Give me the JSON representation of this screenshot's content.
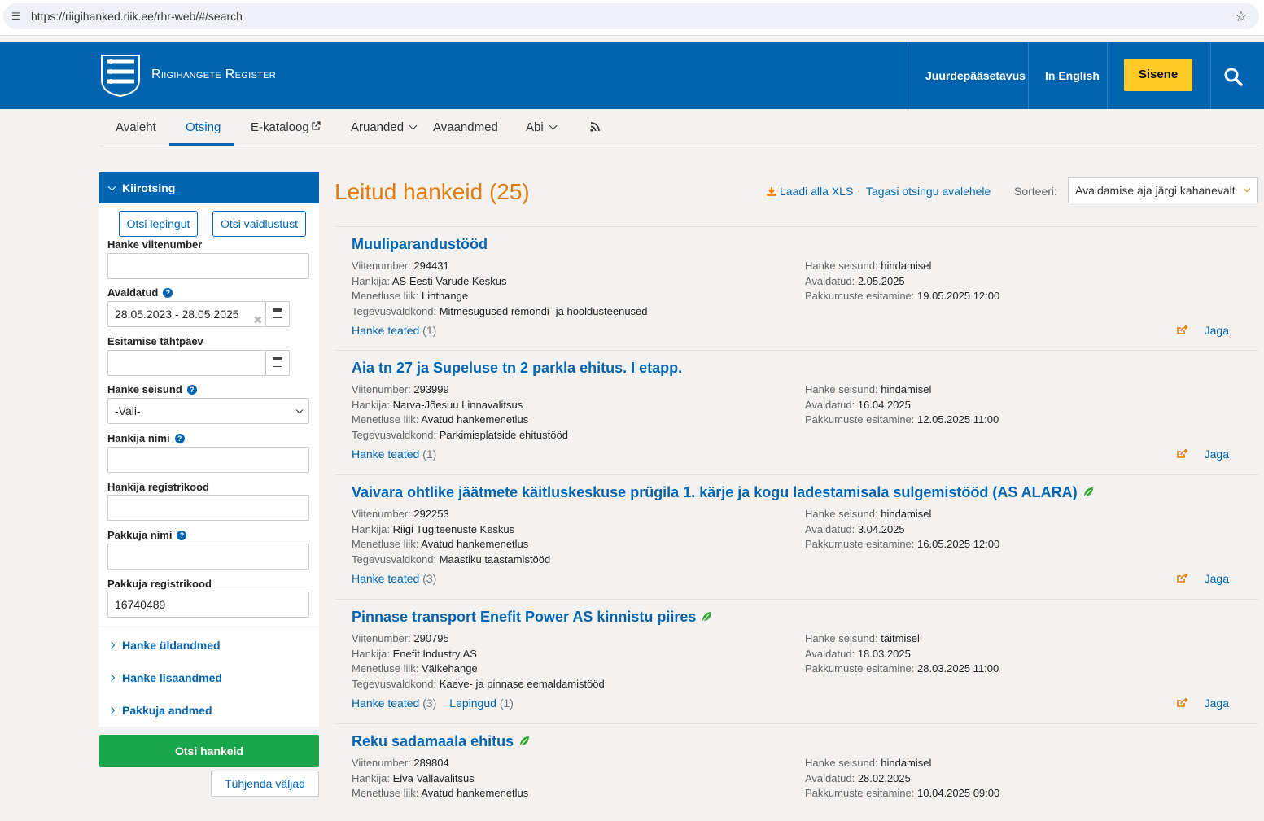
{
  "browser": {
    "url": "https://riigihanked.riik.ee/rhr-web/#/search"
  },
  "header": {
    "brand": "Riigihangete Register",
    "accessibility": "Juurdepääsetavus",
    "english": "In English",
    "login": "Sisene"
  },
  "nav": {
    "items": [
      "Avaleht",
      "Otsing",
      "E-kataloog",
      "Aruanded",
      "Avaandmed",
      "Abi"
    ]
  },
  "sidebar": {
    "title": "Kiirotsing",
    "btn_contract": "Otsi lepingut",
    "btn_dispute": "Otsi vaidlustust",
    "f_ref": "Hanke viitenumber",
    "f_published": "Avaldatud",
    "published_value": "28.05.2023 - 28.05.2025",
    "f_deadline": "Esitamise tähtpäev",
    "f_state": "Hanke seisund",
    "state_value": "-Vali-",
    "f_buyer": "Hankija nimi",
    "f_buyer_reg": "Hankija registrikood",
    "f_bidder": "Pakkuja nimi",
    "f_bidder_reg": "Pakkuja registrikood",
    "bidder_reg_value": "16740489",
    "acc1": "Hanke üldandmed",
    "acc2": "Hanke lisaandmed",
    "acc3": "Pakkuja andmed",
    "search_btn": "Otsi hankeid",
    "clear_btn": "Tühjenda väljad"
  },
  "results": {
    "title_prefix": "Leitud hankeid",
    "count": "(25)",
    "download": "Laadi alla XLS",
    "back": "Tagasi otsingu avalehele",
    "sort_label": "Sorteeri:",
    "sort_value": "Avaldamise aja järgi kahanevalt",
    "labels": {
      "ref": "Viitenumber:",
      "buyer": "Hankija:",
      "proc": "Menetluse liik:",
      "field": "Tegevusvaldkond:",
      "state": "Hanke seisund:",
      "pub": "Avaldatud:",
      "bids": "Pakkumuste esitamine:",
      "notices": "Hanke teated",
      "contracts": "Lepingud",
      "share": "Jaga"
    },
    "items": [
      {
        "title": "Muuliparandustööd",
        "ref": "294431",
        "buyer": "AS Eesti Varude Keskus",
        "proc": "Lihthange",
        "field": "Mitmesugused remondi- ja hooldusteenused",
        "state": "hindamisel",
        "pub": "2.05.2025",
        "bids": "19.05.2025 12:00",
        "notices": "(1)"
      },
      {
        "title": "Aia tn 27 ja Supeluse tn 2 parkla ehitus. I etapp.",
        "ref": "293999",
        "buyer": "Narva-Jõesuu Linnavalitsus",
        "proc": "Avatud hankemenetlus",
        "field": "Parkimisplatside ehitustööd",
        "state": "hindamisel",
        "pub": "16.04.2025",
        "bids": "12.05.2025 11:00",
        "notices": "(1)"
      },
      {
        "title": "Vaivara ohtlike jäätmete käitluskeskuse prügila 1. kärje ja kogu ladestamisala sulgemistööd (AS ALARA)",
        "ref": "292253",
        "buyer": "Riigi Tugiteenuste Keskus",
        "proc": "Avatud hankemenetlus",
        "field": "Maastiku taastamistööd",
        "state": "hindamisel",
        "pub": "3.04.2025",
        "bids": "16.05.2025 12:00",
        "notices": "(3)"
      },
      {
        "title": "Pinnase transport Enefit Power AS kinnistu piires",
        "ref": "290795",
        "buyer": "Enefit Industry AS",
        "proc": "Väikehange",
        "field": "Kaeve- ja pinnase eemaldamistööd",
        "state": "täitmisel",
        "pub": "18.03.2025",
        "bids": "28.03.2025 11:00",
        "notices": "(3)",
        "contracts": "(1)"
      },
      {
        "title": "Reku sadamaala ehitus",
        "ref": "289804",
        "buyer": "Elva Vallavalitsus",
        "proc": "Avatud hankemenetlus",
        "state": "hindamisel",
        "pub": "28.02.2025",
        "bids": "10.04.2025 09:00"
      }
    ]
  }
}
